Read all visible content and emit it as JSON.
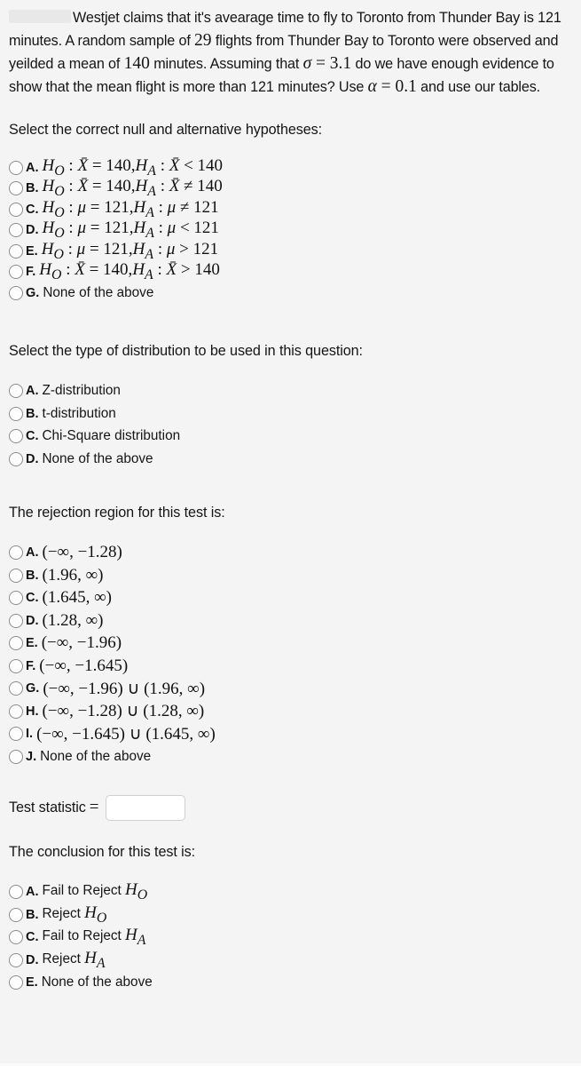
{
  "question": {
    "redacted_prefix": "",
    "paragraph_parts": [
      {
        "t": "Westjet claims that it's avearage time to fly to Toronto from Thunder Bay is 121 minutes. A random sample of ",
        "style": "plain"
      },
      {
        "t": "29",
        "style": "math"
      },
      {
        "t": " flights from Thunder Bay to Toronto were observed and yeilded a mean of ",
        "style": "plain"
      },
      {
        "t": "140",
        "style": "math"
      },
      {
        "t": " minutes. Assuming that ",
        "style": "plain"
      },
      {
        "t": "σ",
        "style": "math-italic"
      },
      {
        "t": " = ",
        "style": "math"
      },
      {
        "t": "3.1",
        "style": "math"
      },
      {
        "t": " do we have enough evidence to show that the mean flight is more than 121 minutes? Use ",
        "style": "plain"
      },
      {
        "t": "α",
        "style": "math-italic"
      },
      {
        "t": " = ",
        "style": "math"
      },
      {
        "t": "0.1",
        "style": "math"
      },
      {
        "t": " and use our tables.",
        "style": "plain"
      }
    ],
    "full_text": "Westjet claims that it's avearage time to fly to Toronto from Thunder Bay is 121 minutes. A random sample of 29 flights from Thunder Bay to Toronto were observed and yeilded a mean of 140 minutes. Assuming that σ = 3.1 do we have enough evidence to show that the mean flight is more than 121 minutes? Use α = 0.1 and use our tables."
  },
  "sections": {
    "hypotheses": {
      "prompt": "Select the correct null and alternative hypotheses:",
      "options": [
        {
          "label": "A.",
          "text": "H_O : X̄ = 140,H_A : X̄ < 140"
        },
        {
          "label": "B.",
          "text": "H_O : X̄ = 140,H_A : X̄ ≠ 140"
        },
        {
          "label": "C.",
          "text": "H_O : μ = 121,H_A : μ ≠ 121"
        },
        {
          "label": "D.",
          "text": "H_O : μ = 121,H_A : μ < 121"
        },
        {
          "label": "E.",
          "text": "H_O : μ = 121,H_A : μ > 121"
        },
        {
          "label": "F.",
          "text": "H_O : X̄ = 140,H_A : X̄ > 140"
        },
        {
          "label": "G.",
          "text": "None of the above"
        }
      ]
    },
    "distribution": {
      "prompt": "Select the type of distribution to be used in this question:",
      "options": [
        {
          "label": "A.",
          "text": "Z-distribution"
        },
        {
          "label": "B.",
          "text": "t-distribution"
        },
        {
          "label": "C.",
          "text": "Chi-Square distribution"
        },
        {
          "label": "D.",
          "text": "None of the above"
        }
      ]
    },
    "rejection_region": {
      "prompt": "The rejection region for this test is:",
      "options": [
        {
          "label": "A.",
          "text": "(−∞, −1.28)"
        },
        {
          "label": "B.",
          "text": "(1.96, ∞)"
        },
        {
          "label": "C.",
          "text": "(1.645, ∞)"
        },
        {
          "label": "D.",
          "text": "(1.28, ∞)"
        },
        {
          "label": "E.",
          "text": "(−∞, −1.96)"
        },
        {
          "label": "F.",
          "text": "(−∞, −1.645)"
        },
        {
          "label": "G.",
          "text": "(−∞, −1.96) ∪ (1.96, ∞)"
        },
        {
          "label": "H.",
          "text": "(−∞, −1.28) ∪ (1.28, ∞)"
        },
        {
          "label": "I.",
          "text": "(−∞, −1.645) ∪ (1.645, ∞)"
        },
        {
          "label": "J.",
          "text": "None of the above"
        }
      ]
    },
    "test_statistic": {
      "label": "Test statistic",
      "equals": "=",
      "value": "",
      "placeholder": ""
    },
    "conclusion": {
      "prompt": "The conclusion for this test is:",
      "options": [
        {
          "label": "A.",
          "prefix": "Fail to Reject ",
          "math": "H_O"
        },
        {
          "label": "B.",
          "prefix": "Reject ",
          "math": "H_O"
        },
        {
          "label": "C.",
          "prefix": "Fail to Reject ",
          "math": "H_A"
        },
        {
          "label": "D.",
          "prefix": "Reject ",
          "math": "H_A"
        },
        {
          "label": "E.",
          "prefix": "None of the above",
          "math": ""
        }
      ]
    }
  },
  "colors": {
    "background": "#f4f4f4",
    "text": "#151515",
    "radio_border": "#8c8c8c",
    "input_border": "#cfcfcf",
    "redaction": "#e8e8e8"
  }
}
